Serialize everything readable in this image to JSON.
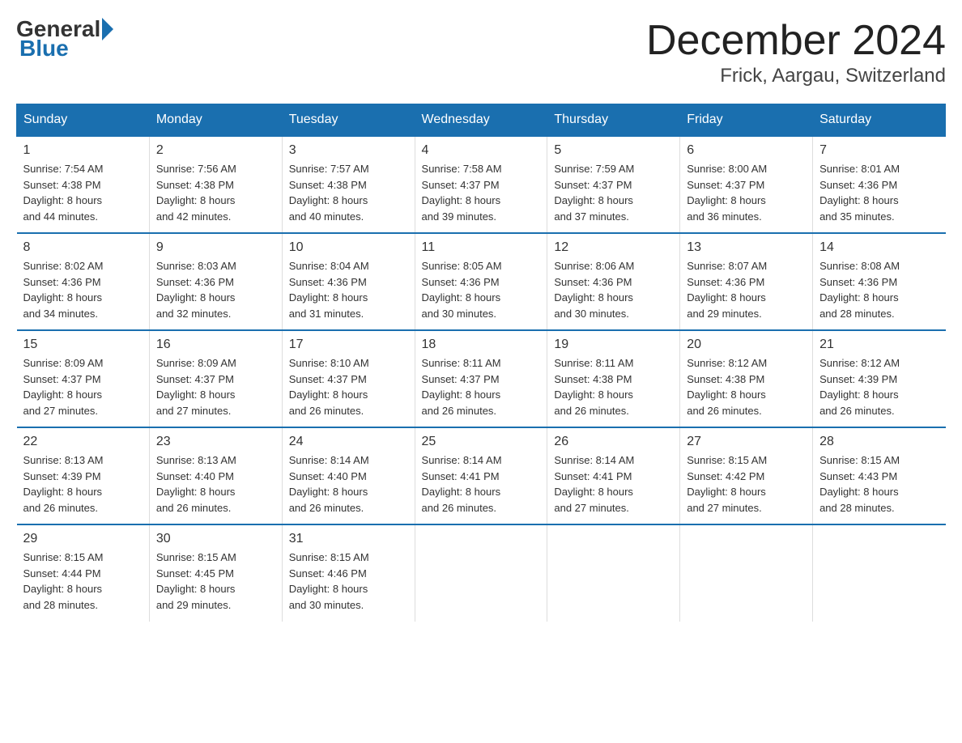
{
  "logo": {
    "general": "General",
    "blue": "Blue"
  },
  "title": "December 2024",
  "subtitle": "Frick, Aargau, Switzerland",
  "headers": [
    "Sunday",
    "Monday",
    "Tuesday",
    "Wednesday",
    "Thursday",
    "Friday",
    "Saturday"
  ],
  "weeks": [
    [
      {
        "day": "1",
        "sunrise": "7:54 AM",
        "sunset": "4:38 PM",
        "daylight": "8 hours and 44 minutes."
      },
      {
        "day": "2",
        "sunrise": "7:56 AM",
        "sunset": "4:38 PM",
        "daylight": "8 hours and 42 minutes."
      },
      {
        "day": "3",
        "sunrise": "7:57 AM",
        "sunset": "4:38 PM",
        "daylight": "8 hours and 40 minutes."
      },
      {
        "day": "4",
        "sunrise": "7:58 AM",
        "sunset": "4:37 PM",
        "daylight": "8 hours and 39 minutes."
      },
      {
        "day": "5",
        "sunrise": "7:59 AM",
        "sunset": "4:37 PM",
        "daylight": "8 hours and 37 minutes."
      },
      {
        "day": "6",
        "sunrise": "8:00 AM",
        "sunset": "4:37 PM",
        "daylight": "8 hours and 36 minutes."
      },
      {
        "day": "7",
        "sunrise": "8:01 AM",
        "sunset": "4:36 PM",
        "daylight": "8 hours and 35 minutes."
      }
    ],
    [
      {
        "day": "8",
        "sunrise": "8:02 AM",
        "sunset": "4:36 PM",
        "daylight": "8 hours and 34 minutes."
      },
      {
        "day": "9",
        "sunrise": "8:03 AM",
        "sunset": "4:36 PM",
        "daylight": "8 hours and 32 minutes."
      },
      {
        "day": "10",
        "sunrise": "8:04 AM",
        "sunset": "4:36 PM",
        "daylight": "8 hours and 31 minutes."
      },
      {
        "day": "11",
        "sunrise": "8:05 AM",
        "sunset": "4:36 PM",
        "daylight": "8 hours and 30 minutes."
      },
      {
        "day": "12",
        "sunrise": "8:06 AM",
        "sunset": "4:36 PM",
        "daylight": "8 hours and 30 minutes."
      },
      {
        "day": "13",
        "sunrise": "8:07 AM",
        "sunset": "4:36 PM",
        "daylight": "8 hours and 29 minutes."
      },
      {
        "day": "14",
        "sunrise": "8:08 AM",
        "sunset": "4:36 PM",
        "daylight": "8 hours and 28 minutes."
      }
    ],
    [
      {
        "day": "15",
        "sunrise": "8:09 AM",
        "sunset": "4:37 PM",
        "daylight": "8 hours and 27 minutes."
      },
      {
        "day": "16",
        "sunrise": "8:09 AM",
        "sunset": "4:37 PM",
        "daylight": "8 hours and 27 minutes."
      },
      {
        "day": "17",
        "sunrise": "8:10 AM",
        "sunset": "4:37 PM",
        "daylight": "8 hours and 26 minutes."
      },
      {
        "day": "18",
        "sunrise": "8:11 AM",
        "sunset": "4:37 PM",
        "daylight": "8 hours and 26 minutes."
      },
      {
        "day": "19",
        "sunrise": "8:11 AM",
        "sunset": "4:38 PM",
        "daylight": "8 hours and 26 minutes."
      },
      {
        "day": "20",
        "sunrise": "8:12 AM",
        "sunset": "4:38 PM",
        "daylight": "8 hours and 26 minutes."
      },
      {
        "day": "21",
        "sunrise": "8:12 AM",
        "sunset": "4:39 PM",
        "daylight": "8 hours and 26 minutes."
      }
    ],
    [
      {
        "day": "22",
        "sunrise": "8:13 AM",
        "sunset": "4:39 PM",
        "daylight": "8 hours and 26 minutes."
      },
      {
        "day": "23",
        "sunrise": "8:13 AM",
        "sunset": "4:40 PM",
        "daylight": "8 hours and 26 minutes."
      },
      {
        "day": "24",
        "sunrise": "8:14 AM",
        "sunset": "4:40 PM",
        "daylight": "8 hours and 26 minutes."
      },
      {
        "day": "25",
        "sunrise": "8:14 AM",
        "sunset": "4:41 PM",
        "daylight": "8 hours and 26 minutes."
      },
      {
        "day": "26",
        "sunrise": "8:14 AM",
        "sunset": "4:41 PM",
        "daylight": "8 hours and 27 minutes."
      },
      {
        "day": "27",
        "sunrise": "8:15 AM",
        "sunset": "4:42 PM",
        "daylight": "8 hours and 27 minutes."
      },
      {
        "day": "28",
        "sunrise": "8:15 AM",
        "sunset": "4:43 PM",
        "daylight": "8 hours and 28 minutes."
      }
    ],
    [
      {
        "day": "29",
        "sunrise": "8:15 AM",
        "sunset": "4:44 PM",
        "daylight": "8 hours and 28 minutes."
      },
      {
        "day": "30",
        "sunrise": "8:15 AM",
        "sunset": "4:45 PM",
        "daylight": "8 hours and 29 minutes."
      },
      {
        "day": "31",
        "sunrise": "8:15 AM",
        "sunset": "4:46 PM",
        "daylight": "8 hours and 30 minutes."
      },
      null,
      null,
      null,
      null
    ]
  ],
  "labels": {
    "sunrise": "Sunrise:",
    "sunset": "Sunset:",
    "daylight": "Daylight:"
  }
}
